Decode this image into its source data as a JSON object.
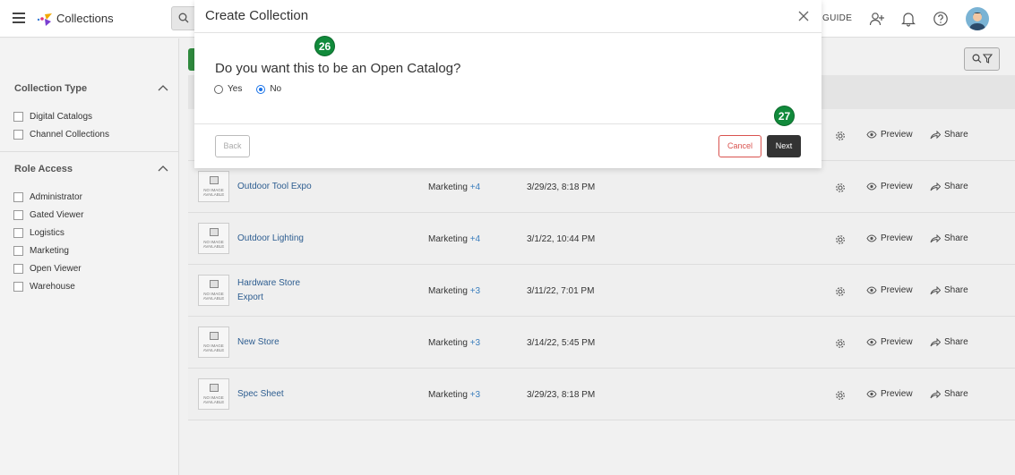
{
  "header": {
    "app_title": "Collections",
    "guide_label": "GUIDE"
  },
  "sidebar": {
    "sections": [
      {
        "title": "Collection Type",
        "options": [
          "Digital Catalogs",
          "Channel Collections"
        ]
      },
      {
        "title": "Role Access",
        "options": [
          "Administrator",
          "Gated Viewer",
          "Logistics",
          "Marketing",
          "Open Viewer",
          "Warehouse"
        ]
      }
    ]
  },
  "rows": [
    {
      "name": "Outdoor Tool Expo",
      "role": "Marketing",
      "more": "+4",
      "date": "3/29/23, 8:18 PM",
      "preview": "Preview",
      "share": "Share",
      "thumb": "NO IMAGE AVAILABLE"
    },
    {
      "name": "Outdoor Lighting",
      "role": "Marketing",
      "more": "+4",
      "date": "3/1/22, 10:44 PM",
      "preview": "Preview",
      "share": "Share",
      "thumb": "NO IMAGE AVAILABLE"
    },
    {
      "name": "Hardware Store Export",
      "role": "Marketing",
      "more": "+3",
      "date": "3/11/22, 7:01 PM",
      "preview": "Preview",
      "share": "Share",
      "thumb": "NO IMAGE AVAILABLE"
    },
    {
      "name": "New Store",
      "role": "Marketing",
      "more": "+3",
      "date": "3/14/22, 5:45 PM",
      "preview": "Preview",
      "share": "Share",
      "thumb": "NO IMAGE AVAILABLE"
    },
    {
      "name": "Spec Sheet",
      "role": "Marketing",
      "more": "+3",
      "date": "3/29/23, 8:18 PM",
      "preview": "Preview",
      "share": "Share",
      "thumb": "NO IMAGE AVAILABLE"
    }
  ],
  "partial_row": {
    "preview": "Preview",
    "share": "Share"
  },
  "modal": {
    "title": "Create Collection",
    "question": "Do you want this to be an Open Catalog?",
    "options": {
      "yes": "Yes",
      "no": "No"
    },
    "selected": "No",
    "back_label": "Back",
    "cancel_label": "Cancel",
    "next_label": "Next"
  },
  "step_badges": {
    "question": "26",
    "next": "27"
  },
  "colors": {
    "accent_green": "#118a3b",
    "link_blue": "#2d5d90",
    "cancel_red": "#d9534f",
    "primary_dark": "#333333"
  }
}
